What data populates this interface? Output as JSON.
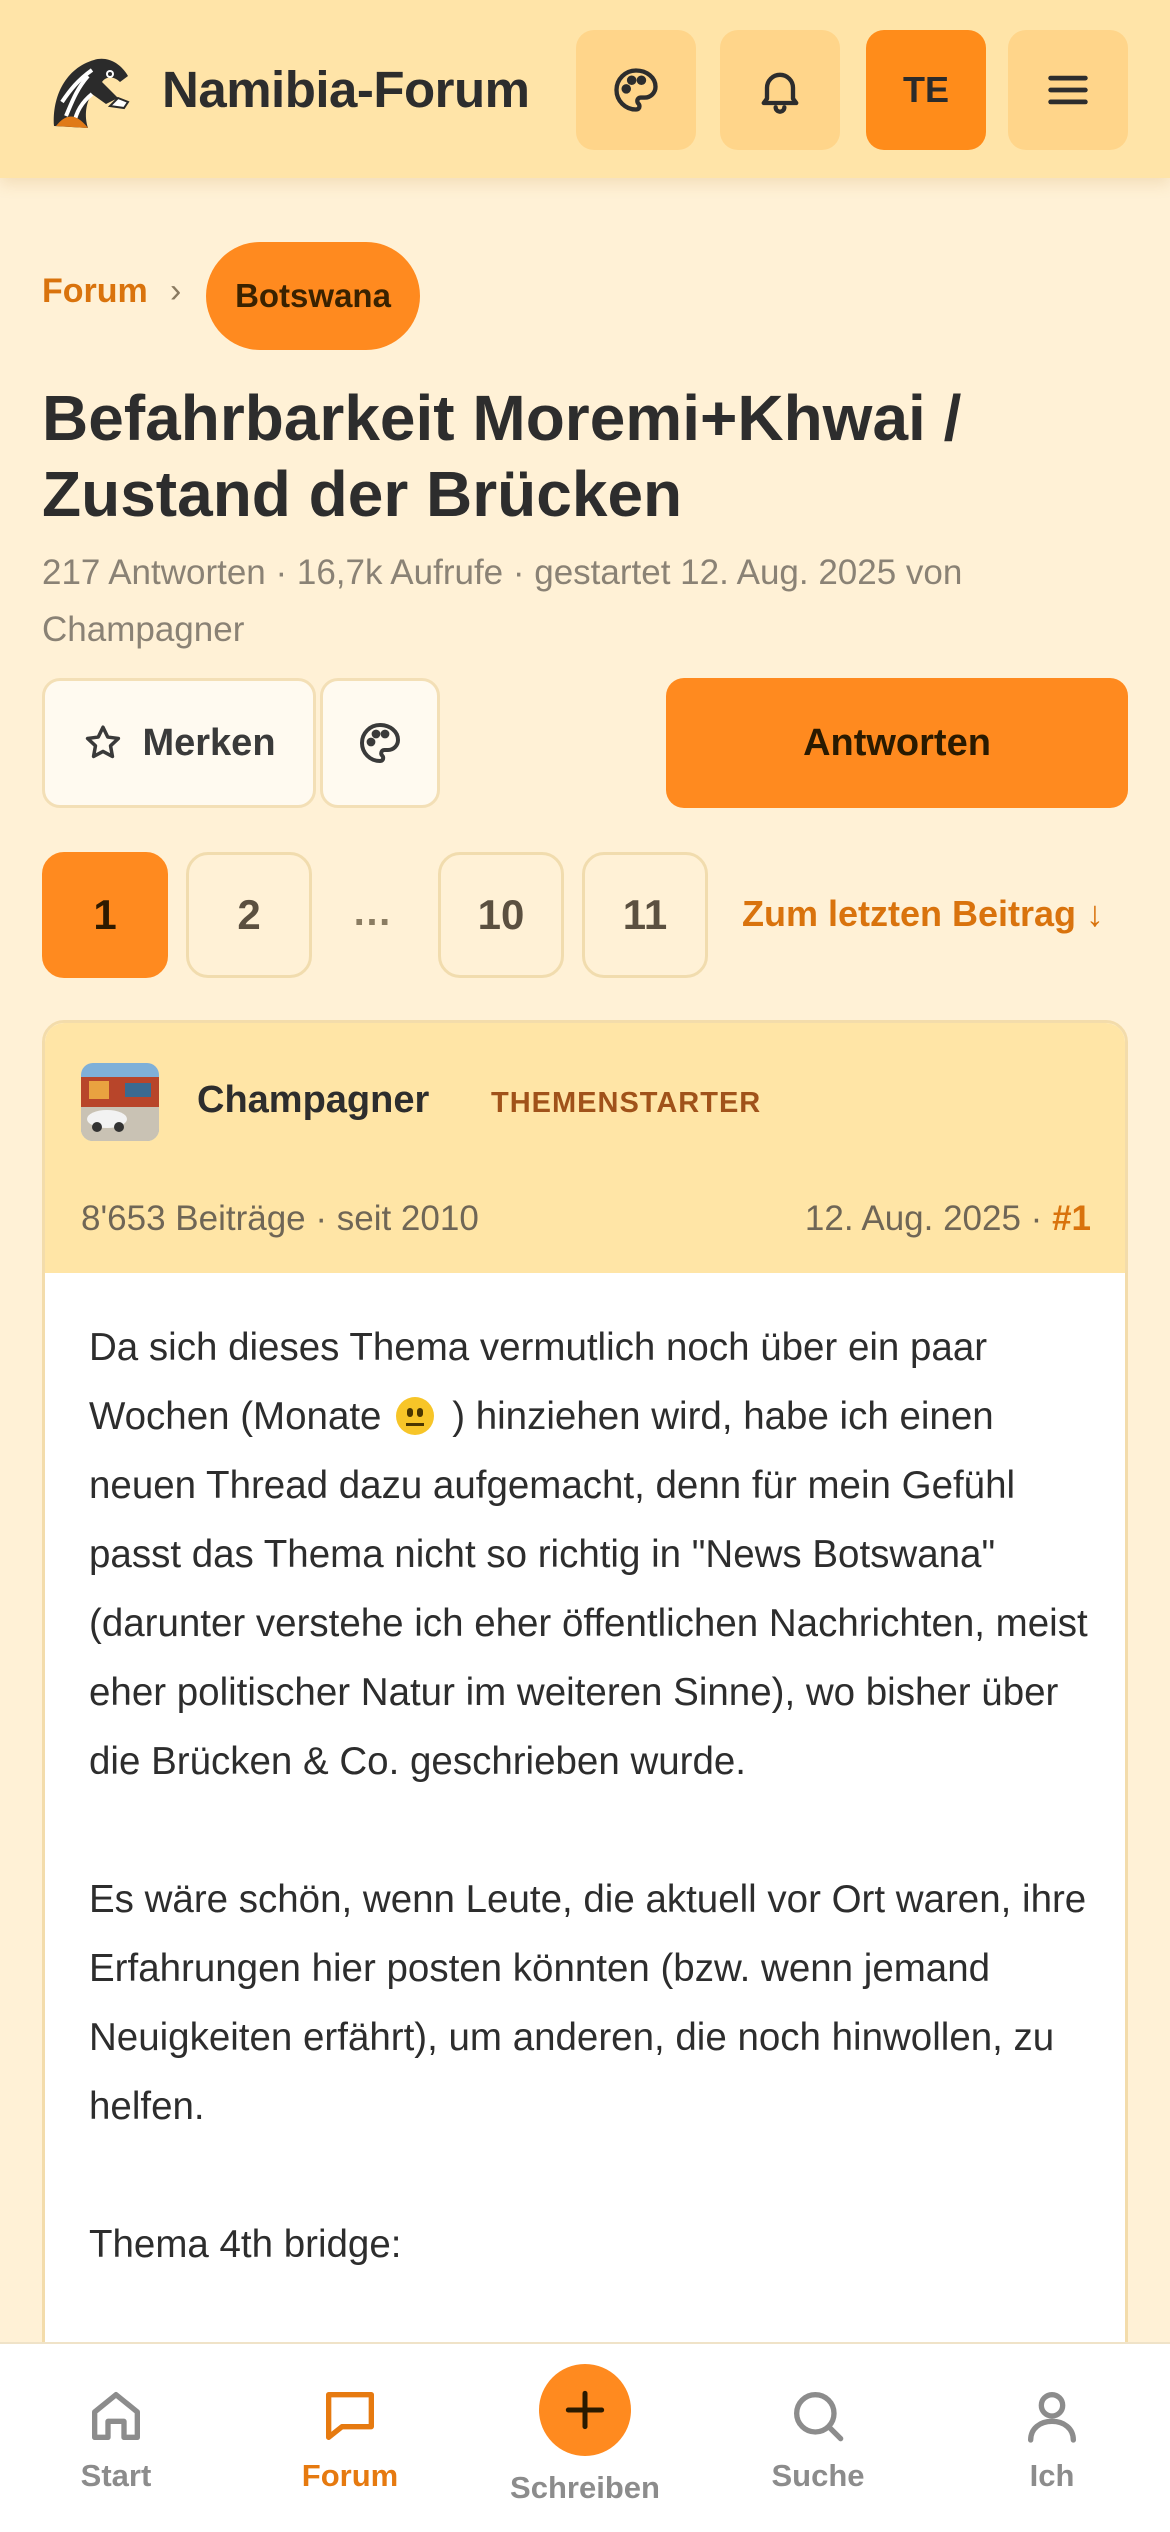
{
  "header": {
    "brand": "Namibia-Forum",
    "avatar_initials": "TE",
    "icons": [
      "zebra-logo",
      "palette-icon",
      "bell-icon",
      "menu-icon"
    ]
  },
  "breadcrumb": {
    "root": "Forum",
    "separator": "›",
    "current": "Botswana"
  },
  "thread": {
    "title": "Befahrbarkeit Moremi+Khwai / Zustand der Brücken",
    "meta": "217 Antworten · 16,7k Aufrufe · gestartet 12. Aug. 2025 von Champagner"
  },
  "actions": {
    "bookmark_label": "Merken",
    "reply_label": "Antworten"
  },
  "pagination": {
    "pages": [
      "1",
      "2",
      "10",
      "11"
    ],
    "ellipsis": "…",
    "active": "1",
    "jump_last": "Zum letzten Beitrag ↓"
  },
  "post": {
    "author": "Champagner",
    "badge": "THEMENSTARTER",
    "stats": "8'653 Beiträge · seit 2010",
    "date": "12. Aug. 2025 · ",
    "number": "#1",
    "paragraph1_before_emoji": "Da sich dieses Thema vermutlich noch über ein paar Wochen (Monate",
    "paragraph1_after_emoji": ") hinziehen wird, habe ich einen neuen Thread dazu aufgemacht, denn für mein Gefühl passt das Thema nicht so richtig in \"News Botswana\" (darunter verstehe ich eher öffentlichen Nachrichten, meist eher politischer Natur im weiteren Sinne), wo bisher über die Brücken & Co. geschrieben wurde.",
    "paragraph2": "Es wäre schön, wenn Leute, die aktuell vor Ort waren, ihre Erfahrungen hier posten könnten (bzw. wenn jemand Neuigkeiten erfährt), um anderen, die noch hinwollen, zu helfen.",
    "paragraph3": "Thema 4th bridge:"
  },
  "bottom_nav": {
    "start": "Start",
    "forum": "Forum",
    "write": "Schreiben",
    "search": "Suche",
    "me": "Ich",
    "active": "Forum"
  },
  "colors": {
    "accent": "#ff8a1f",
    "accent_text": "#d9730d",
    "page_bg": "#fff1d6",
    "header_bg": "#ffe4a8"
  }
}
